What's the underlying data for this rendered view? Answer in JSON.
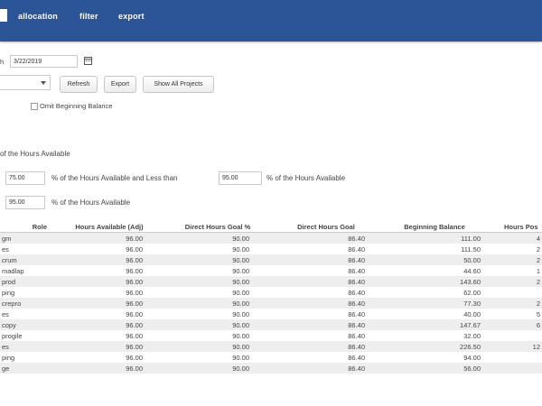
{
  "nav": {
    "items": [
      "allocation",
      "filter",
      "export"
    ]
  },
  "filters": {
    "date_prefix": "h",
    "date_value": "3/22/2019",
    "buttons": {
      "refresh": "Refresh",
      "export": "Export",
      "show_all": "Show All Projects"
    },
    "omit_label": "Omit Beginning Balance"
  },
  "thresholds": {
    "line1": "of the Hours Available",
    "line2_value_a": "75.00",
    "line2_middle": "% of the Hours Available and Less than",
    "line2_value_b": "95.00",
    "line2_suffix": "% of the Hours Available",
    "line3_value": "95.00",
    "line3_suffix": "% of the Hours Available"
  },
  "table": {
    "columns": [
      "Role",
      "Hours Available (Adj)",
      "Direct Hours Goal %",
      "Direct Hours Goal",
      "Beginning Balance",
      "Hours Pos"
    ],
    "rows": [
      [
        "gm",
        "96.00",
        "90.00",
        "86.40",
        "111.00",
        "4"
      ],
      [
        "es",
        "96.00",
        "90.00",
        "86.40",
        "111.50",
        "2"
      ],
      [
        "crum",
        "96.00",
        "90.00",
        "86.40",
        "50.00",
        "2"
      ],
      [
        "madlap",
        "96.00",
        "90.00",
        "86.40",
        "44.60",
        "1"
      ],
      [
        "prod",
        "96.00",
        "90.00",
        "86.40",
        "143.60",
        "2"
      ],
      [
        "ping",
        "96.00",
        "90.00",
        "86.40",
        "62.00",
        ""
      ],
      [
        "crepro",
        "96.00",
        "90.00",
        "86.40",
        "77.30",
        "2"
      ],
      [
        "es",
        "96.00",
        "90.00",
        "86.40",
        "40.00",
        "5"
      ],
      [
        "copy",
        "96.00",
        "90.00",
        "86.40",
        "147.67",
        "6"
      ],
      [
        "progile",
        "96.00",
        "90.00",
        "86.40",
        "32.00",
        ""
      ],
      [
        "es",
        "96.00",
        "90.00",
        "86.40",
        "226.50",
        "12"
      ],
      [
        "ping",
        "96.00",
        "90.00",
        "86.40",
        "94.00",
        ""
      ],
      [
        "ge",
        "96.00",
        "90.00",
        "86.40",
        "56.00",
        ""
      ]
    ]
  }
}
